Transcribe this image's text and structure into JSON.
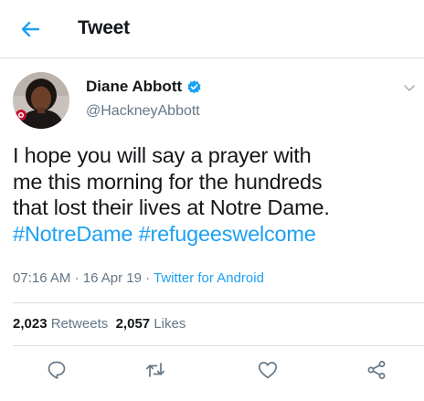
{
  "header": {
    "title": "Tweet",
    "back_icon": "back-arrow-icon",
    "accent_color": "#1da1f2"
  },
  "tweet": {
    "author": {
      "name": "Diane Abbott",
      "handle": "@HackneyAbbott",
      "verified": true,
      "avatar_icon": "profile-photo"
    },
    "text_lines": [
      "I hope you will say a prayer with",
      "me this morning for the hundreds",
      "that lost their lives at Notre Dame."
    ],
    "hashtags": [
      "#NotreDame",
      "#refugeeswelcome"
    ],
    "time": "07:16 AM",
    "date": "16 Apr 19",
    "separator": "·",
    "source": "Twitter for Android"
  },
  "stats": {
    "retweets_count": "2,023",
    "retweets_label": "Retweets",
    "likes_count": "2,057",
    "likes_label": "Likes"
  },
  "actions": {
    "icons": [
      "reply-icon",
      "retweet-icon",
      "like-icon",
      "share-icon"
    ],
    "icon_color": "#657786"
  }
}
